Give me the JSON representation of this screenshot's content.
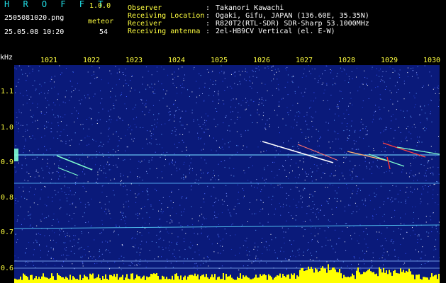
{
  "app": {
    "title": "H R O F F T",
    "version": "1.0.0"
  },
  "file": {
    "name": "2505081020.png",
    "datetime": "25.05.08 10:20"
  },
  "meteor": {
    "label": "meteor",
    "count": "54"
  },
  "metadata": [
    {
      "key": "Observer",
      "value": "Takanori Kawachi"
    },
    {
      "key": "Receiving Location",
      "value": "Ogaki, Gifu, JAPAN (136.60E, 35.35N)"
    },
    {
      "key": "Receiver",
      "value": "R820T2(RTL-SDR) SDR-Sharp 53.1000MHz"
    },
    {
      "key": "Receiving antenna",
      "value": "2el-HB9CV Vertical (el. E-W)"
    }
  ],
  "axes": {
    "y_unit": "kHz",
    "x_ticks": [
      "1021",
      "1022",
      "1023",
      "1024",
      "1025",
      "1026",
      "1027",
      "1028",
      "1029",
      "1030"
    ],
    "y_ticks": [
      "1.1",
      "1.0",
      "0.9",
      "0.8",
      "0.7",
      "0.6"
    ]
  },
  "colors": {
    "background": "#000000",
    "spectrogram_bg": "#0a1a7a",
    "label_yellow": "#ffff40",
    "title_cyan": "#22e0e8",
    "text_white": "#ffffff",
    "baseline_bars": "#ffff00"
  }
}
